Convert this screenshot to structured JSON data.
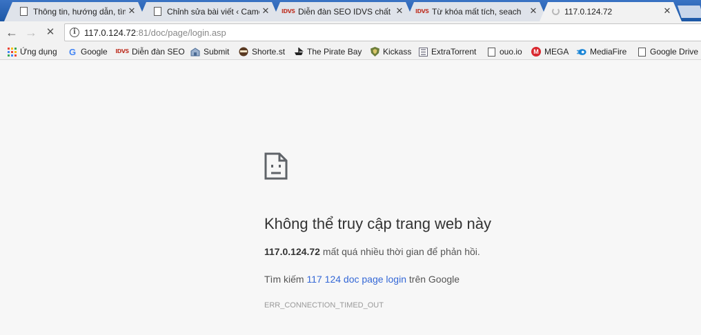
{
  "tabs": [
    {
      "title": "Thông tin, hướng dẫn, tìm",
      "favicon": "document-icon"
    },
    {
      "title": "Chỉnh sửa bài viết ‹ Came",
      "favicon": "document-icon"
    },
    {
      "title": "Diễn đàn SEO IDVS chất",
      "favicon": "idvs-logo"
    },
    {
      "title": "Từ khóa mất tích, seach",
      "favicon": "idvs-logo"
    },
    {
      "title": "117.0.124.72",
      "favicon": "loading-spinner",
      "active": true
    }
  ],
  "tab_favicon_text": "IDVS",
  "close_glyph": "✕",
  "toolbar": {
    "back": "←",
    "forward": "→",
    "stop": "✕",
    "info_glyph": "i",
    "url_host": "117.0.124.72",
    "url_rest": ":81/doc/page/login.asp"
  },
  "bookmarks": [
    {
      "label": "Ứng dụng",
      "icon": "apps-grid-icon"
    },
    {
      "label": "Google",
      "icon": "google-icon"
    },
    {
      "label": "Diễn đàn SEO",
      "icon": "idvs-icon"
    },
    {
      "label": "Submit",
      "icon": "submit-icon"
    },
    {
      "label": "Shorte.st",
      "icon": "shortest-icon"
    },
    {
      "label": "The Pirate Bay",
      "icon": "pirate-icon"
    },
    {
      "label": "Kickass",
      "icon": "kickass-icon"
    },
    {
      "label": "ExtraTorrent",
      "icon": "extratorrent-icon"
    },
    {
      "label": "ouo.io",
      "icon": "document-icon"
    },
    {
      "label": "MEGA",
      "icon": "mega-icon"
    },
    {
      "label": "MediaFire",
      "icon": "mediafire-icon"
    },
    {
      "label": "Google Drive",
      "icon": "document-icon"
    }
  ],
  "bookmark_icon_text": {
    "google": "G",
    "idvs": "IDVS",
    "mega": "M"
  },
  "error": {
    "title": "Không thể truy cập trang web này",
    "host": "117.0.124.72",
    "message": " mất quá nhiều thời gian để phản hồi.",
    "suggest_prefix": "Tìm kiếm ",
    "suggest_link": "117 124 doc page login",
    "suggest_suffix": " trên Google",
    "code": "ERR_CONNECTION_TIMED_OUT"
  },
  "colors": {
    "tabstrip": "#1d58a6",
    "link": "#3367d6",
    "background": "#f7f7f7"
  }
}
